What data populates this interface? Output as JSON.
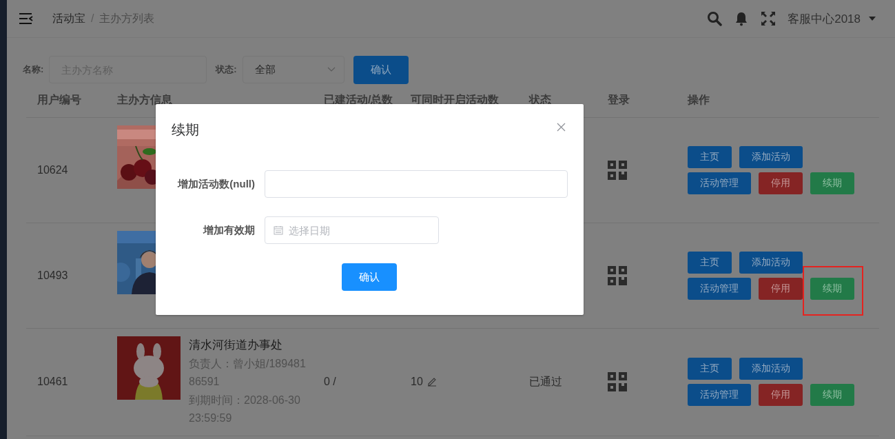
{
  "header": {
    "breadcrumb": [
      "活动宝",
      "主办方列表"
    ],
    "separator": "/",
    "user": "客服中心2018"
  },
  "filter": {
    "name_label": "名称:",
    "name_placeholder": "主办方名称",
    "status_label": "状态:",
    "status_value": "全部",
    "button": "确认"
  },
  "table": {
    "columns": [
      "用户编号",
      "主办方信息",
      "已建活动/总数",
      "可同时开启活动数",
      "状态",
      "登录",
      "操作"
    ],
    "rows": [
      {
        "user_id": "10624",
        "actions": [
          {
            "label": "主页",
            "kind": "primary",
            "highlighted": false
          },
          {
            "label": "添加活动",
            "kind": "primary",
            "highlighted": false
          },
          {
            "label": "活动管理",
            "kind": "primary",
            "highlighted": false
          },
          {
            "label": "停用",
            "kind": "danger",
            "highlighted": false
          },
          {
            "label": "续期",
            "kind": "success",
            "highlighted": false
          }
        ]
      },
      {
        "user_id": "10493",
        "actions": [
          {
            "label": "主页",
            "kind": "primary",
            "highlighted": false
          },
          {
            "label": "添加活动",
            "kind": "primary",
            "highlighted": false
          },
          {
            "label": "活动管理",
            "kind": "primary",
            "highlighted": false
          },
          {
            "label": "停用",
            "kind": "danger",
            "highlighted": false
          },
          {
            "label": "续期",
            "kind": "success",
            "highlighted": true
          }
        ]
      },
      {
        "user_id": "10461",
        "name": "清水河街道办事处",
        "contact": "负责人：曾小姐/18948186591",
        "expiry": "到期时间：2028-06-30 23:59:59",
        "activities": "0 /",
        "concurrent": "10",
        "status": "已通过",
        "actions": [
          {
            "label": "主页",
            "kind": "primary",
            "highlighted": false
          },
          {
            "label": "添加活动",
            "kind": "primary",
            "highlighted": false
          },
          {
            "label": "活动管理",
            "kind": "primary",
            "highlighted": false
          },
          {
            "label": "停用",
            "kind": "danger",
            "highlighted": false
          },
          {
            "label": "续期",
            "kind": "success",
            "highlighted": false
          }
        ]
      }
    ]
  },
  "dialog": {
    "title": "续期",
    "fields": [
      {
        "kind": "text",
        "label": "增加活动数(null)"
      },
      {
        "kind": "date",
        "label": "增加有效期",
        "placeholder": "选择日期"
      }
    ],
    "button": "确认"
  }
}
